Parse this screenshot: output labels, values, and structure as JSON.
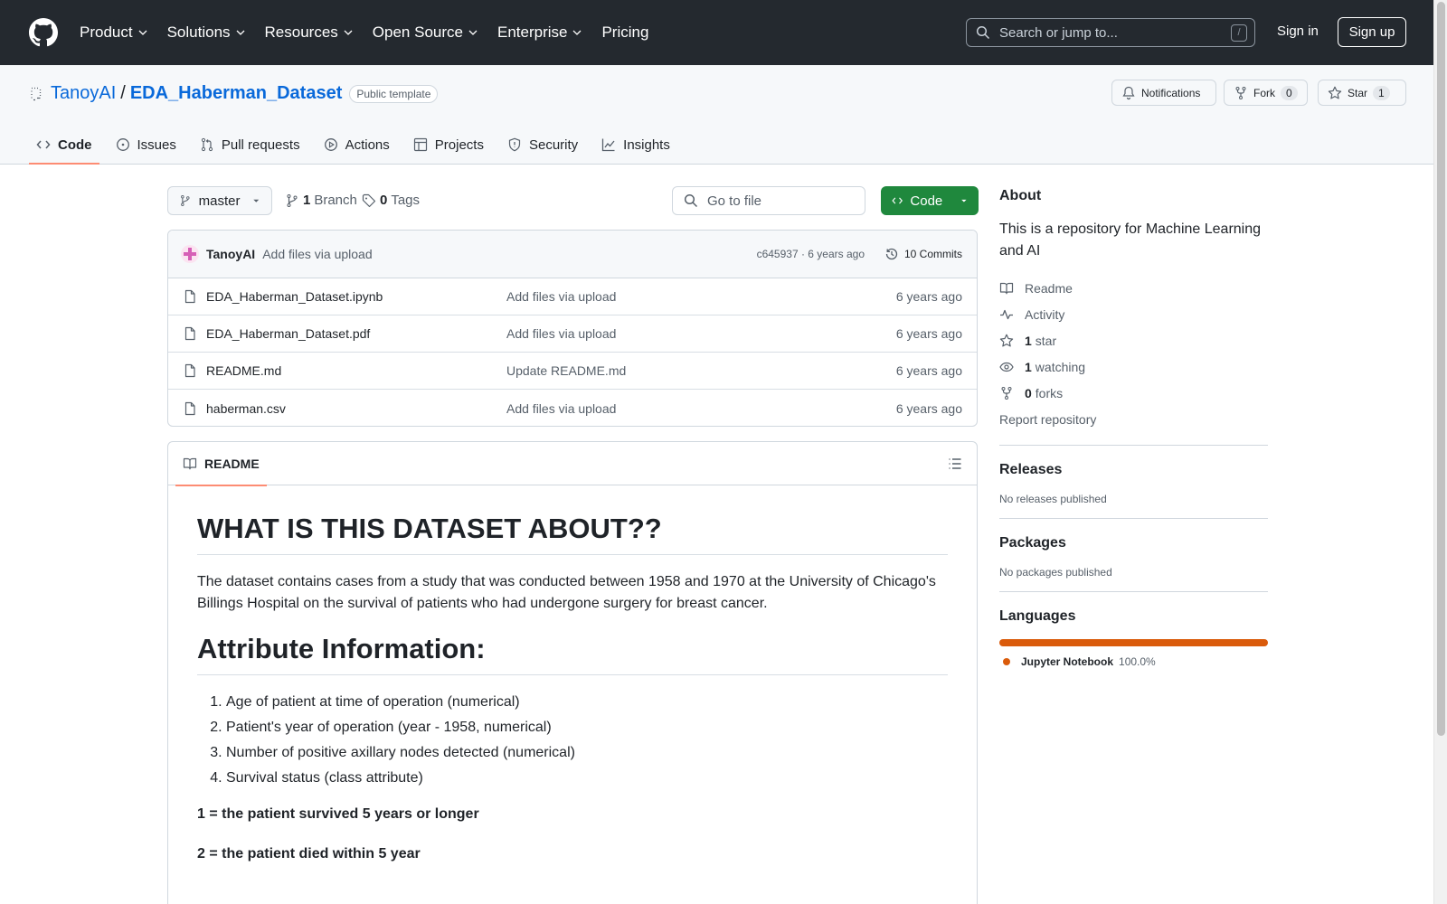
{
  "header": {
    "nav": [
      {
        "label": "Product",
        "dropdown": true
      },
      {
        "label": "Solutions",
        "dropdown": true
      },
      {
        "label": "Resources",
        "dropdown": true
      },
      {
        "label": "Open Source",
        "dropdown": true
      },
      {
        "label": "Enterprise",
        "dropdown": true
      },
      {
        "label": "Pricing",
        "dropdown": false
      }
    ],
    "search_placeholder": "Search or jump to...",
    "search_shortcut": "/",
    "sign_in": "Sign in",
    "sign_up": "Sign up"
  },
  "repo": {
    "owner": "TanoyAI",
    "separator": "/",
    "name": "EDA_Haberman_Dataset",
    "visibility": "Public template",
    "notifications_label": "Notifications",
    "fork_label": "Fork",
    "fork_count": "0",
    "star_label": "Star",
    "star_count": "1",
    "tabs": [
      {
        "label": "Code",
        "icon": "code-icon",
        "active": true
      },
      {
        "label": "Issues",
        "icon": "issue-icon",
        "active": false
      },
      {
        "label": "Pull requests",
        "icon": "pull-request-icon",
        "active": false
      },
      {
        "label": "Actions",
        "icon": "play-icon",
        "active": false
      },
      {
        "label": "Projects",
        "icon": "table-icon",
        "active": false
      },
      {
        "label": "Security",
        "icon": "shield-icon",
        "active": false
      },
      {
        "label": "Insights",
        "icon": "graph-icon",
        "active": false
      }
    ]
  },
  "files": {
    "branch": "master",
    "branch_count": "1",
    "branch_label": "Branch",
    "tag_count": "0",
    "tag_label": "Tags",
    "goto_placeholder": "Go to file",
    "code_button": "Code",
    "commit": {
      "author": "TanoyAI",
      "message": "Add files via upload",
      "hash_age": "c645937 · 6 years ago",
      "commits_label": "10 Commits"
    },
    "rows": [
      {
        "name": "EDA_Haberman_Dataset.ipynb",
        "message": "Add files via upload",
        "age": "6 years ago"
      },
      {
        "name": "EDA_Haberman_Dataset.pdf",
        "message": "Add files via upload",
        "age": "6 years ago"
      },
      {
        "name": "README.md",
        "message": "Update README.md",
        "age": "6 years ago"
      },
      {
        "name": "haberman.csv",
        "message": "Add files via upload",
        "age": "6 years ago"
      }
    ]
  },
  "readme": {
    "tab_label": "README",
    "h1": "WHAT IS THIS DATASET ABOUT??",
    "intro": "The dataset contains cases from a study that was conducted between 1958 and 1970 at the University of Chicago's Billings Hospital on the survival of patients who had undergone surgery for breast cancer.",
    "h2": "Attribute Information:",
    "attributes": [
      "Age of patient at time of operation (numerical)",
      "Patient's year of operation (year - 1958, numerical)",
      "Number of positive axillary nodes detected (numerical)",
      "Survival status (class attribute)"
    ],
    "status1": "1 = the patient survived 5 years or longer",
    "status2": "2 = the patient died within 5 year"
  },
  "sidebar": {
    "about_title": "About",
    "about_desc": "This is a repository for Machine Learning and AI",
    "readme": "Readme",
    "activity": "Activity",
    "stars_count": "1",
    "stars_label": "star",
    "watching_count": "1",
    "watching_label": "watching",
    "forks_count": "0",
    "forks_label": "forks",
    "report": "Report repository",
    "releases_title": "Releases",
    "releases_text": "No releases published",
    "packages_title": "Packages",
    "packages_text": "No packages published",
    "languages_title": "Languages",
    "language": {
      "name": "Jupyter Notebook",
      "percent": "100.0%",
      "color": "#da5b0b"
    }
  },
  "colors": {
    "header_bg": "#24292f",
    "link": "#0969da",
    "primary_button": "#1f883d",
    "active_tab_underline": "#fd8c73"
  }
}
